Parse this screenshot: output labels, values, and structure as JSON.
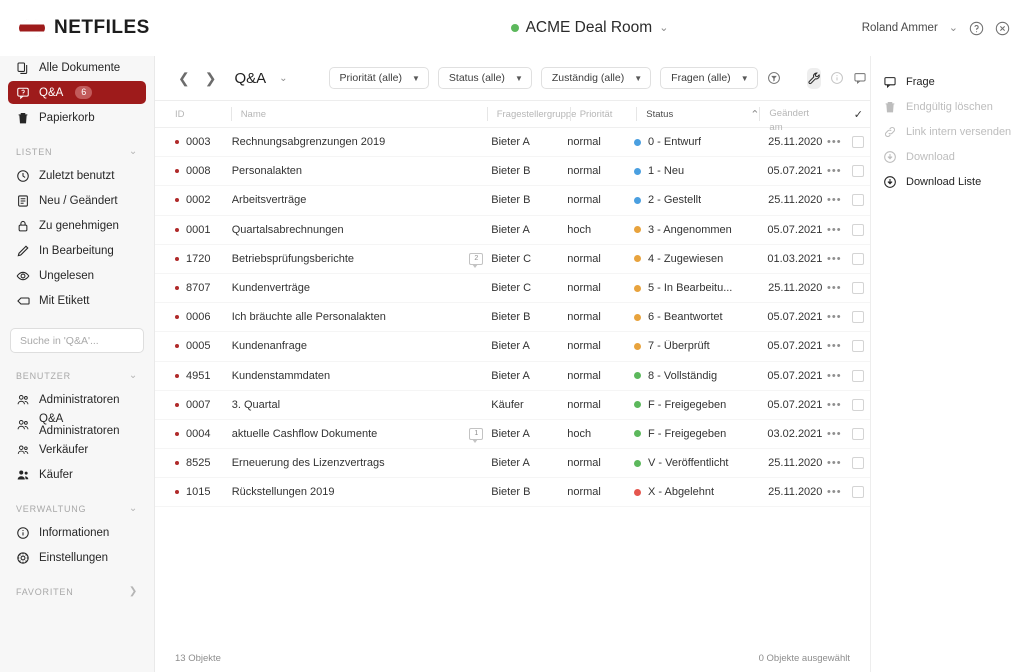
{
  "brand": {
    "name": "NETFILES",
    "logo_icon": "netfiles-logo-icon",
    "accent": "#9e1b1b"
  },
  "topbar": {
    "deal_room": "ACME Deal Room",
    "deal_room_status_color": "#5cb85c",
    "deal_room_chevron": "⌄",
    "user": "Roland Ammer",
    "user_chevron": "⌄",
    "help_icon": "help-circle-icon",
    "close_icon": "close-circle-icon"
  },
  "sidebar": {
    "primary": [
      {
        "label": "Alle Dokumente",
        "icon": "documents-icon",
        "active": false,
        "badge": null
      },
      {
        "label": "Q&A",
        "icon": "qa-bubble-icon",
        "active": true,
        "badge": "6"
      },
      {
        "label": "Papierkorb",
        "icon": "trash-icon",
        "active": false,
        "badge": null
      }
    ],
    "sections": [
      {
        "title": "LISTEN",
        "collapse_icon": "chevron-down-icon",
        "items": [
          {
            "label": "Zuletzt benutzt",
            "icon": "clock-icon"
          },
          {
            "label": "Neu / Geändert",
            "icon": "list-icon"
          },
          {
            "label": "Zu genehmigen",
            "icon": "lock-icon"
          },
          {
            "label": "In Bearbeitung",
            "icon": "pencil-icon"
          },
          {
            "label": "Ungelesen",
            "icon": "eye-icon"
          },
          {
            "label": "Mit Etikett",
            "icon": "tag-icon"
          }
        ]
      },
      {
        "title": "BENUTZER",
        "collapse_icon": "chevron-down-icon",
        "items": [
          {
            "label": "Administratoren",
            "icon": "users-icon"
          },
          {
            "label": "Q&A Administratoren",
            "icon": "users-icon"
          },
          {
            "label": "Verkäufer",
            "icon": "users-icon"
          },
          {
            "label": "Käufer",
            "icon": "users-filled-icon"
          }
        ]
      },
      {
        "title": "VERWALTUNG",
        "collapse_icon": "chevron-down-icon",
        "items": [
          {
            "label": "Informationen",
            "icon": "info-circle-icon"
          },
          {
            "label": "Einstellungen",
            "icon": "gear-icon"
          }
        ]
      }
    ],
    "search": {
      "placeholder": "Suche in 'Q&A'...",
      "value": ""
    },
    "favorites": {
      "title": "FAVORITEN",
      "collapse_icon": "chevron-right-icon"
    }
  },
  "toolbar": {
    "back_icon": "chevron-left-icon",
    "forward_icon": "chevron-right-icon",
    "breadcrumb": "Q&A",
    "breadcrumb_chevron": "⌄",
    "edit_icon": "edit-square-icon",
    "filters": [
      {
        "label": "Priorität (alle)",
        "name": "prioritaet-filter"
      },
      {
        "label": "Status (alle)",
        "name": "status-filter"
      },
      {
        "label": "Zuständig (alle)",
        "name": "zustaendig-filter"
      },
      {
        "label": "Fragen (alle)",
        "name": "fragen-filter"
      }
    ],
    "caret": "▼",
    "clear_filter_icon": "filter-clear-icon",
    "wrench_icon": "wrench-icon",
    "info_icon": "info-circle-icon",
    "comment_icon": "comment-icon"
  },
  "table": {
    "columns": [
      {
        "key": "id",
        "label": "ID"
      },
      {
        "key": "name",
        "label": "Name"
      },
      {
        "key": "group",
        "label": "Fragestellergruppe"
      },
      {
        "key": "prio",
        "label": "Priorität"
      },
      {
        "key": "status",
        "label": "Status"
      },
      {
        "key": "date",
        "label": "Geändert am"
      }
    ],
    "sort_column": "Status",
    "sort_icon": "⌃",
    "select_all_icon": "✓",
    "row_menu_glyph": "•••",
    "rows": [
      {
        "id": "0003",
        "name": "Rechnungsabgrenzungen 2019",
        "comments": null,
        "group": "Bieter A",
        "prio": "normal",
        "status": "0 - Entwurf",
        "status_color": "#4a9fe0",
        "date": "25.11.2020"
      },
      {
        "id": "0008",
        "name": "Personalakten",
        "comments": null,
        "group": "Bieter B",
        "prio": "normal",
        "status": "1 - Neu",
        "status_color": "#4a9fe0",
        "date": "05.07.2021"
      },
      {
        "id": "0002",
        "name": "Arbeitsverträge",
        "comments": null,
        "group": "Bieter B",
        "prio": "normal",
        "status": "2 - Gestellt",
        "status_color": "#4a9fe0",
        "date": "25.11.2020"
      },
      {
        "id": "0001",
        "name": "Quartalsabrechnungen",
        "comments": null,
        "group": "Bieter A",
        "prio": "hoch",
        "status": "3 - Angenommen",
        "status_color": "#e8a33d",
        "date": "05.07.2021"
      },
      {
        "id": "1720",
        "name": "Betriebsprüfungsberichte",
        "comments": "2",
        "group": "Bieter C",
        "prio": "normal",
        "status": "4 - Zugewiesen",
        "status_color": "#e8a33d",
        "date": "01.03.2021"
      },
      {
        "id": "8707",
        "name": "Kundenverträge",
        "comments": null,
        "group": "Bieter C",
        "prio": "normal",
        "status": "5 - In Bearbeitu...",
        "status_color": "#e8a33d",
        "date": "25.11.2020"
      },
      {
        "id": "0006",
        "name": "Ich bräuchte alle Personalakten",
        "comments": null,
        "group": "Bieter B",
        "prio": "normal",
        "status": "6 - Beantwortet",
        "status_color": "#e8a33d",
        "date": "05.07.2021"
      },
      {
        "id": "0005",
        "name": "Kundenanfrage",
        "comments": null,
        "group": "Bieter A",
        "prio": "normal",
        "status": "7 - Überprüft",
        "status_color": "#e8a33d",
        "date": "05.07.2021"
      },
      {
        "id": "4951",
        "name": "Kundenstammdaten",
        "comments": null,
        "group": "Bieter A",
        "prio": "normal",
        "status": "8 - Vollständig",
        "status_color": "#5cb85c",
        "date": "05.07.2021"
      },
      {
        "id": "0007",
        "name": "3. Quartal",
        "comments": null,
        "group": "Käufer",
        "prio": "normal",
        "status": "F - Freigegeben",
        "status_color": "#5cb85c",
        "date": "05.07.2021"
      },
      {
        "id": "0004",
        "name": "aktuelle Cashflow Dokumente",
        "comments": "1",
        "group": "Bieter A",
        "prio": "hoch",
        "status": "F - Freigegeben",
        "status_color": "#5cb85c",
        "date": "03.02.2021"
      },
      {
        "id": "8525",
        "name": "Erneuerung des Lizenzvertrags",
        "comments": null,
        "group": "Bieter A",
        "prio": "normal",
        "status": "V - Veröffentlicht",
        "status_color": "#5cb85c",
        "date": "25.11.2020"
      },
      {
        "id": "1015",
        "name": "Rückstellungen 2019",
        "comments": null,
        "group": "Bieter B",
        "prio": "normal",
        "status": "X - Abgelehnt",
        "status_color": "#e5564e",
        "date": "25.11.2020"
      }
    ]
  },
  "right_panel": {
    "actions": [
      {
        "label": "Frage",
        "icon": "comment-icon",
        "disabled": false
      },
      {
        "label": "Endgültig löschen",
        "icon": "trash-icon",
        "disabled": true
      },
      {
        "label": "Link intern versenden",
        "icon": "link-icon",
        "disabled": true
      },
      {
        "label": "Download",
        "icon": "download-icon",
        "disabled": true
      },
      {
        "label": "Download Liste",
        "icon": "download-icon",
        "disabled": false
      }
    ]
  },
  "footer": {
    "left": "13 Objekte",
    "right": "0 Objekte ausgewählt"
  }
}
